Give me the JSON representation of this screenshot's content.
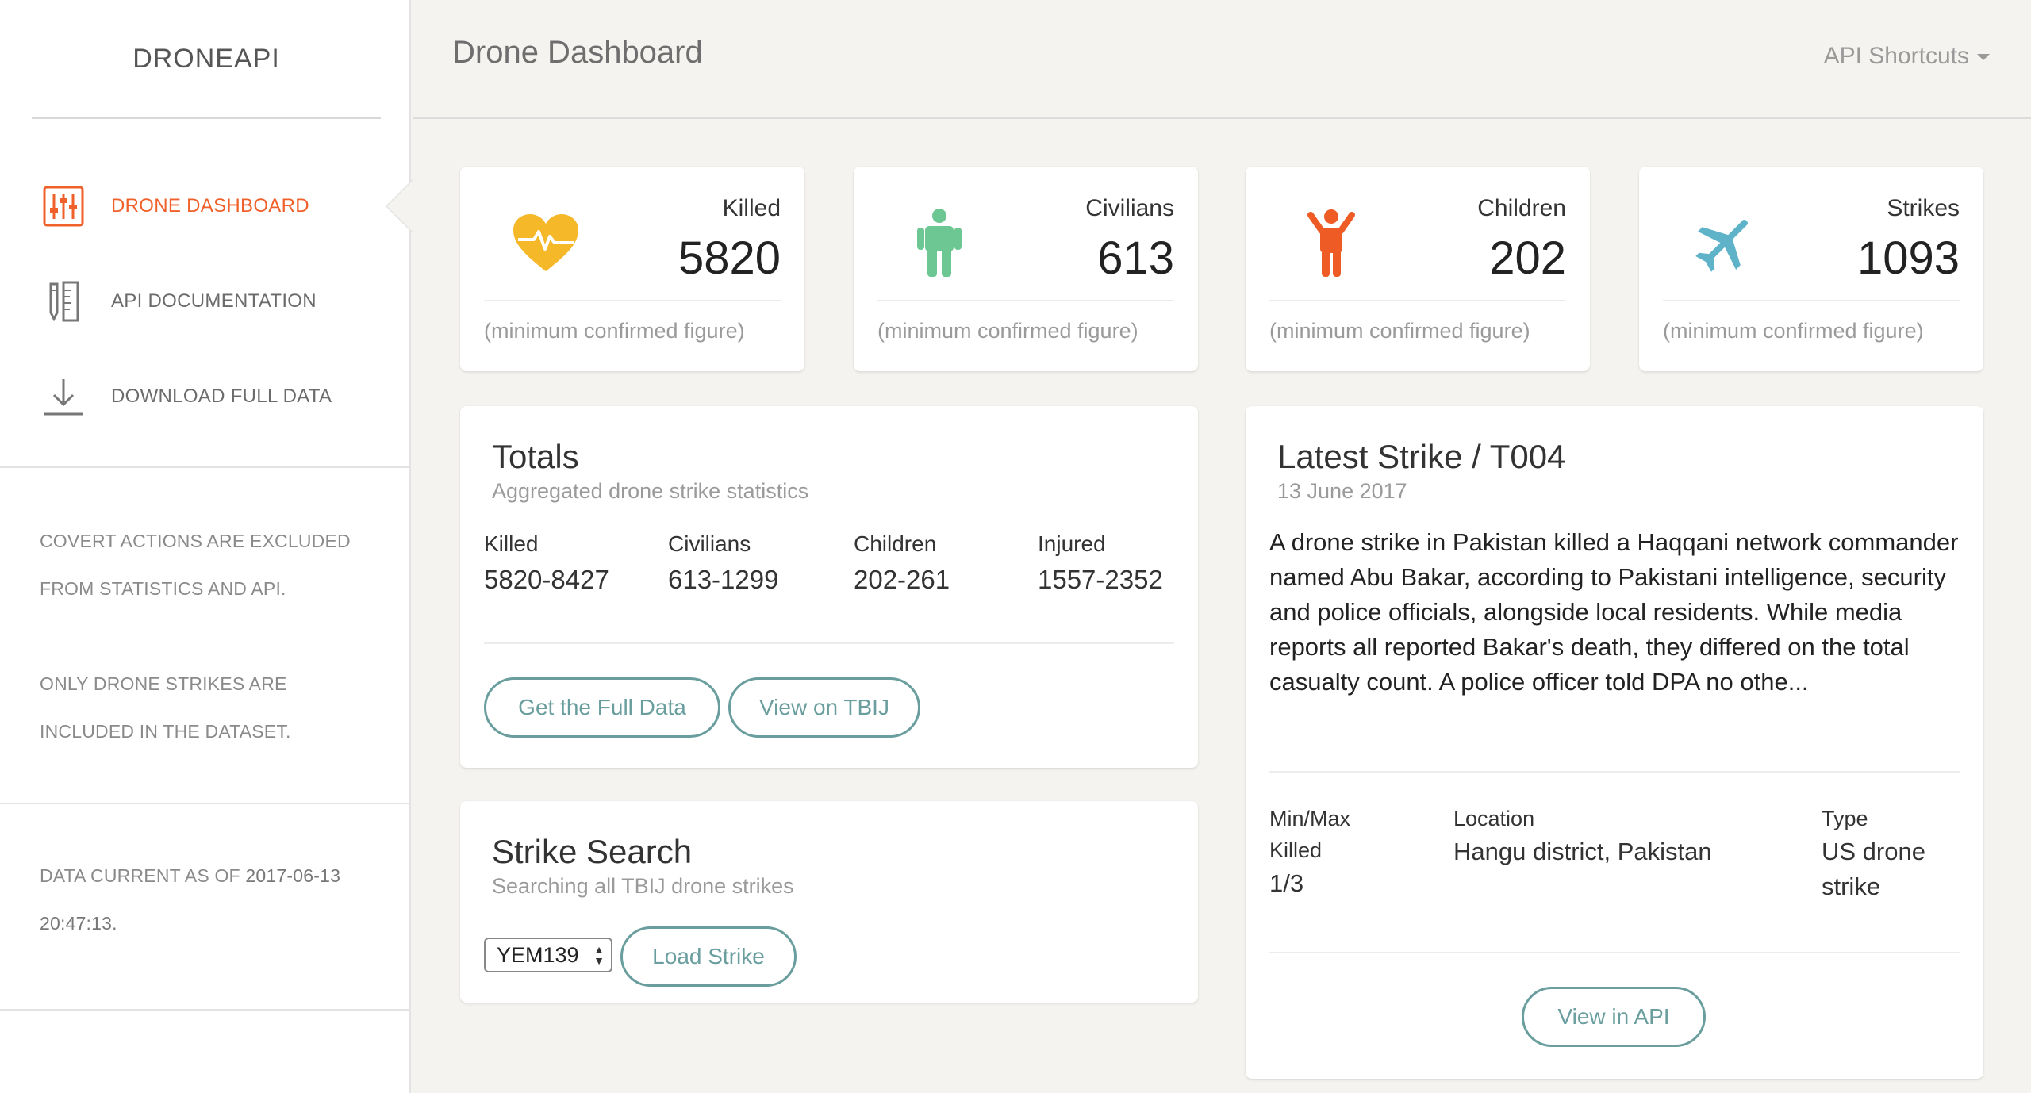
{
  "sidebar": {
    "brand": "DRONEAPI",
    "nav": [
      {
        "label": "DRONE DASHBOARD",
        "icon": "sliders-icon",
        "active": true
      },
      {
        "label": "API DOCUMENTATION",
        "icon": "ruler-pencil-icon",
        "active": false
      },
      {
        "label": "DOWNLOAD FULL DATA",
        "icon": "download-icon",
        "active": false
      }
    ],
    "notes": {
      "covert_line1": "COVERT ACTIONS ARE EXCLUDED",
      "covert_line2": "FROM STATISTICS AND API.",
      "only_line1": "ONLY DRONE STRIKES ARE",
      "only_line2": "INCLUDED IN THE DATASET.",
      "current_prefix": "DATA CURRENT AS OF",
      "current_date": "2017-06-13",
      "current_time": "20:47:13."
    },
    "accent_color": "#f0602a"
  },
  "header": {
    "title": "Drone Dashboard",
    "shortcuts": "API Shortcuts"
  },
  "stats": [
    {
      "label": "Killed",
      "value": "5820",
      "footnote": "(minimum confirmed figure)",
      "icon": "heartbeat-icon",
      "color": "#f5b829"
    },
    {
      "label": "Civilians",
      "value": "613",
      "footnote": "(minimum confirmed figure)",
      "icon": "person-icon",
      "color": "#6dc792"
    },
    {
      "label": "Children",
      "value": "202",
      "footnote": "(minimum confirmed figure)",
      "icon": "child-icon",
      "color": "#ef5b25"
    },
    {
      "label": "Strikes",
      "value": "1093",
      "footnote": "(minimum confirmed figure)",
      "icon": "airplane-icon",
      "color": "#5fb3c9"
    }
  ],
  "totals": {
    "title": "Totals",
    "subtitle": "Aggregated drone strike statistics",
    "columns": [
      {
        "label": "Killed",
        "value": "5820-8427"
      },
      {
        "label": "Civilians",
        "value": "613-1299"
      },
      {
        "label": "Children",
        "value": "202-261"
      },
      {
        "label": "Injured",
        "value": "1557-2352"
      }
    ],
    "btn_full_data": "Get the Full Data",
    "btn_tbij": "View on TBIJ"
  },
  "search": {
    "title": "Strike Search",
    "subtitle": "Searching all TBIJ drone strikes",
    "selected": "YEM139",
    "btn_load": "Load Strike"
  },
  "latest": {
    "title": "Latest Strike / T004",
    "date": "13 June 2017",
    "description": "A drone strike in Pakistan killed a Haqqani network commander named Abu Bakar, according to Pakistani intelligence, security and police officials, alongside local residents.  While media reports all reported Bakar's death, they differed on the total casualty count.  A police officer told DPA no othe...",
    "killed_label_1": "Min/Max",
    "killed_label_2": "Killed",
    "killed_value": "1/3",
    "location_label": "Location",
    "location_value": "Hangu district, Pakistan",
    "type_label": "Type",
    "type_value_1": "US drone",
    "type_value_2": "strike",
    "btn_api": "View in API"
  }
}
